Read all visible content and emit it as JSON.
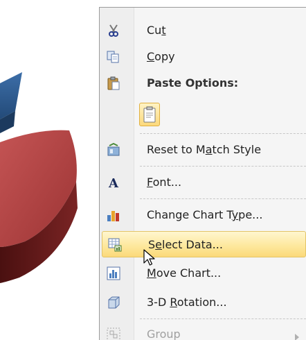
{
  "menu": {
    "items": [
      {
        "before": "Cu",
        "mnemonic": "t",
        "after": "",
        "icon": "scissors-icon"
      },
      {
        "before": "",
        "mnemonic": "C",
        "after": "opy",
        "icon": "copy-icon"
      },
      {
        "label": "Paste Options:",
        "icon": "paste-icon"
      },
      {
        "before": "Reset to M",
        "mnemonic": "a",
        "after": "tch Style",
        "icon": "reset-style-icon"
      },
      {
        "before": "",
        "mnemonic": "F",
        "after": "ont...",
        "icon": "font-icon"
      },
      {
        "before": "Change Chart T",
        "mnemonic": "y",
        "after": "pe...",
        "icon": "chart-type-icon"
      },
      {
        "before": "S",
        "mnemonic": "e",
        "after": "lect Data...",
        "icon": "select-data-icon"
      },
      {
        "before": "",
        "mnemonic": "M",
        "after": "ove Chart...",
        "icon": "move-chart-icon"
      },
      {
        "before": "3-D ",
        "mnemonic": "R",
        "after": "otation...",
        "icon": "3d-rotation-icon"
      },
      {
        "label": "Group",
        "icon": "group-icon"
      }
    ]
  },
  "colors": {
    "highlight": "#fde79a",
    "pie_red": "#a33a3a",
    "pie_blue": "#2e5a8e"
  }
}
